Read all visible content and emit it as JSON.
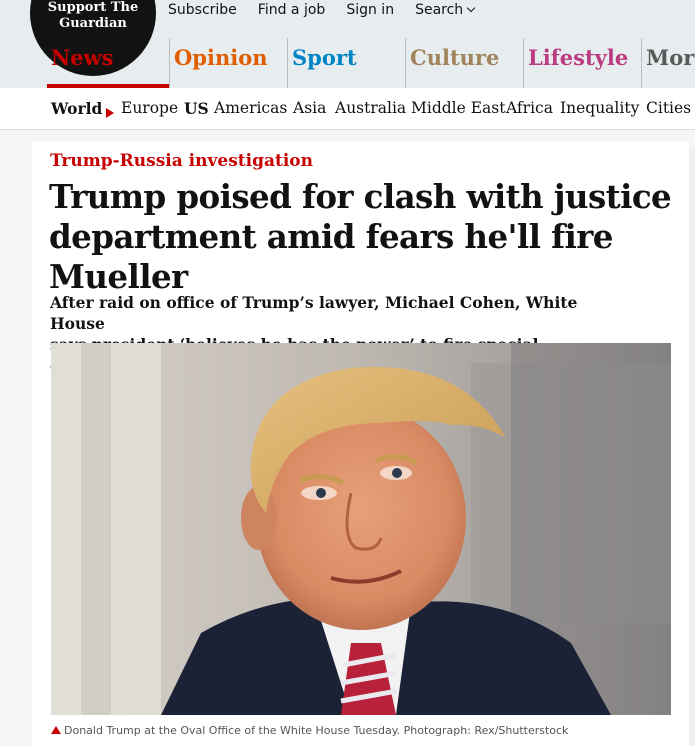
{
  "header": {
    "support_line1": "Support The",
    "support_line2": "Guardian",
    "links": [
      "Subscribe",
      "Find a job",
      "Sign in",
      "Search"
    ]
  },
  "pillars": [
    {
      "label": "News",
      "color": "#c70000"
    },
    {
      "label": "Opinion",
      "color": "#e05e00"
    },
    {
      "label": "Sport",
      "color": "#0084c6"
    },
    {
      "label": "Culture",
      "color": "#a1845c"
    },
    {
      "label": "Lifestyle",
      "color": "#bb3b80"
    },
    {
      "label": "More",
      "color": "#5a5a5a"
    }
  ],
  "subnav": {
    "section": "World",
    "items": [
      "Europe",
      "US",
      "Americas",
      "Asia",
      "Australia",
      "Middle East",
      "Africa",
      "Inequality",
      "Cities"
    ]
  },
  "article": {
    "kicker": "Trump-Russia investigation",
    "headline_line1": "Trump poised for clash with justice",
    "headline_line2": "department amid fears he'll fire Mueller",
    "standfirst_line1": "After raid on office of Trump’s lawyer, Michael Cohen, White House",
    "standfirst_line2": "says president ‘believes he has the power’ to fire special counsel",
    "caption": "Donald Trump at the Oval Office of the White House Tuesday. Photograph: Rex/Shutterstock"
  },
  "icons": {
    "search_dropdown": "chevron-down-icon",
    "caption_marker": "triangle-up-icon",
    "section_marker": "triangle-right-icon"
  }
}
